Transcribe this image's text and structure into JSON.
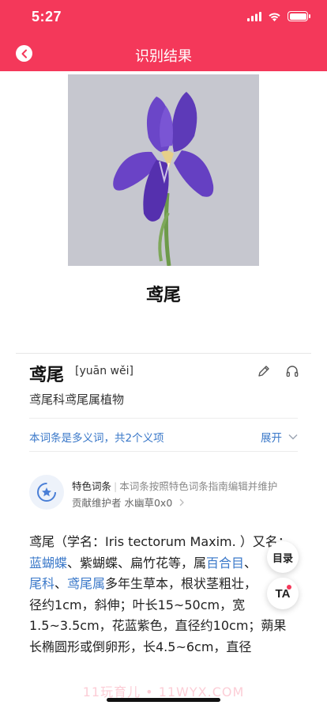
{
  "status_bar": {
    "time": "5:27"
  },
  "nav": {
    "title": "识别结果"
  },
  "result": {
    "name": "鸢尾"
  },
  "entry": {
    "title": "鸢尾",
    "pinyin": "[yuān wěi]",
    "summary": "鸢尾科鸢尾属植物"
  },
  "polysemy": {
    "text": "本词条是多义词，共2个义项",
    "expand_label": "展开"
  },
  "feature": {
    "label": "特色词条",
    "desc": "本词条按照特色词条指南编辑并维护",
    "contributor": "贡献维护者 水幽草0x0"
  },
  "body": {
    "l1": "鸢尾（学名：Iris tectorum Maxim. ）又名：",
    "l2_link1": "蓝蝴蝶",
    "l2_text1": "、紫蝴蝶、扁竹花等，属",
    "l2_link2": "百合目",
    "l2_text2": "、",
    "l3_link1": "尾科",
    "l3_text1": "、",
    "l3_link2": "鸢尾属",
    "l3_text2": "多年生草本，根状茎粗壮，",
    "l4": "径约1cm，斜伸；叶长15~50cm，宽",
    "l5": "1.5~3.5cm，花蓝紫色，直径约10cm；蒴果",
    "l6": "长椭圆形或倒卵形，长4.5~6cm，直径"
  },
  "float": {
    "toc_label": "目录",
    "ta_label": "TA"
  },
  "watermark": "11玩育儿 • 11WYX.COM",
  "colors": {
    "brand": "#f4385a",
    "link": "#3a78c9"
  }
}
